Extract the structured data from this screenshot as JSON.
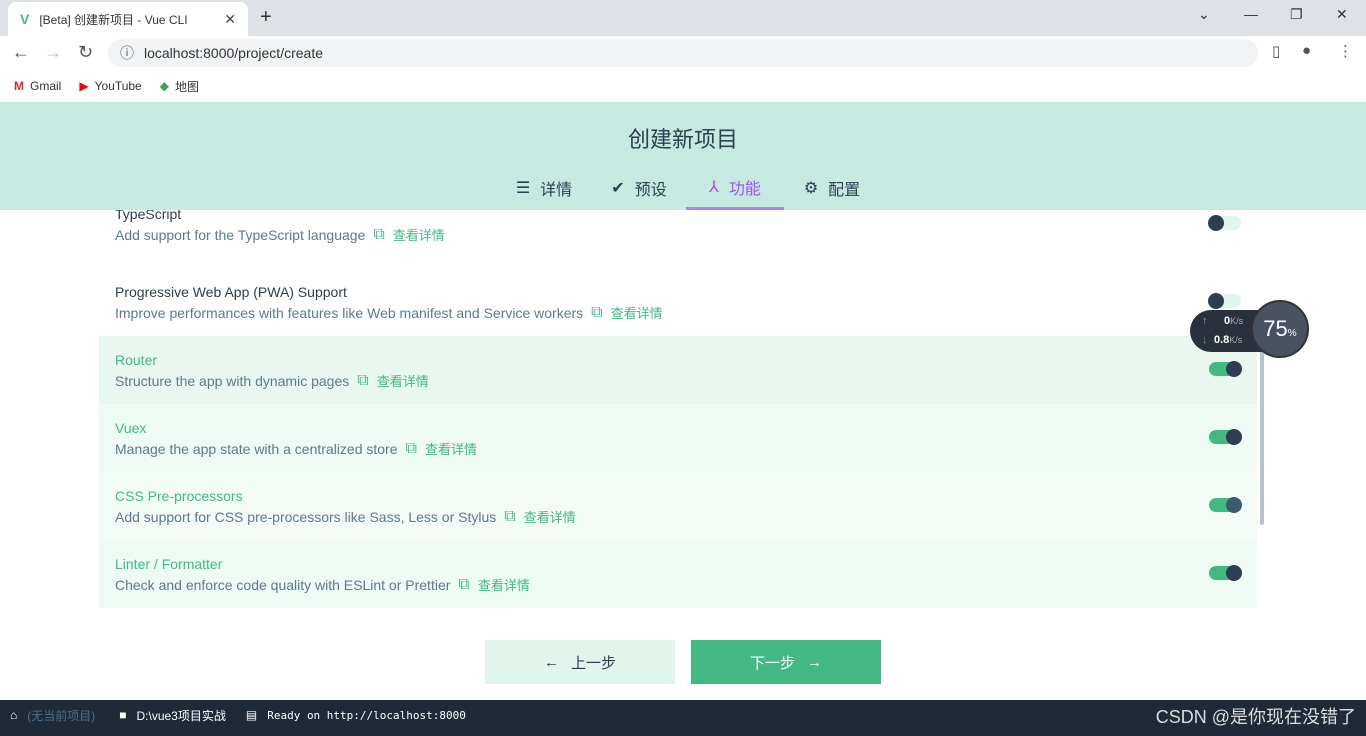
{
  "browser": {
    "tab_title": "[Beta] 创建新项目 - Vue CLI",
    "url": "localhost:8000/project/create",
    "bookmarks": [
      {
        "label": "Gmail"
      },
      {
        "label": "YouTube"
      },
      {
        "label": "地图"
      }
    ]
  },
  "header": {
    "title": "创建新项目",
    "tabs": [
      {
        "label": "详情",
        "icon": "menu-lines-icon"
      },
      {
        "label": "预设",
        "icon": "check-circle-icon"
      },
      {
        "label": "功能",
        "icon": "fork-icon",
        "active": true
      },
      {
        "label": "配置",
        "icon": "gear-icon"
      }
    ]
  },
  "features": [
    {
      "title": "TypeScript",
      "desc": "Add support for the TypeScript language",
      "more": "查看详情",
      "enabled": false
    },
    {
      "title": "Progressive Web App (PWA) Support",
      "desc": "Improve performances with features like Web manifest and Service workers",
      "more": "查看详情",
      "enabled": false
    },
    {
      "title": "Router",
      "desc": "Structure the app with dynamic pages",
      "more": "查看详情",
      "enabled": true
    },
    {
      "title": "Vuex",
      "desc": "Manage the app state with a centralized store",
      "more": "查看详情",
      "enabled": true
    },
    {
      "title": "CSS Pre-processors",
      "desc": "Add support for CSS pre-processors like Sass, Less or Stylus",
      "more": "查看详情",
      "enabled": true
    },
    {
      "title": "Linter / Formatter",
      "desc": "Check and enforce code quality with ESLint or Prettier",
      "more": "查看详情",
      "enabled": true
    }
  ],
  "buttons": {
    "prev": "上一步",
    "next": "下一步"
  },
  "statusbar": {
    "project": "(无当前项目)",
    "folder": "D:\\vue3项目实战",
    "log": "Ready on http://localhost:8000",
    "watermark": "CSDN @是你现在没错了"
  },
  "netmeter": {
    "up": "0",
    "down": "0.8",
    "unit": "K/s",
    "percent": "75",
    "percent_sign": "%"
  },
  "colors": {
    "accent": "#42b983",
    "active_tab": "#a44cf7",
    "header_bg": "#c6eadf"
  }
}
